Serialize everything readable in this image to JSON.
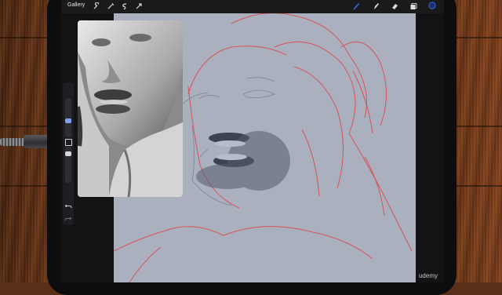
{
  "app": {
    "gallery_label": "Gallery"
  },
  "left_tools": [
    {
      "icon": "wrench-icon"
    },
    {
      "icon": "magic-wand-icon"
    },
    {
      "icon": "selection-icon"
    },
    {
      "icon": "transform-arrow-icon"
    }
  ],
  "right_tools": [
    {
      "icon": "brush-icon",
      "active": true,
      "color": "#3b6ff0"
    },
    {
      "icon": "smudge-icon"
    },
    {
      "icon": "eraser-icon"
    },
    {
      "icon": "layers-icon"
    },
    {
      "icon": "color-swatch-icon",
      "color": "#1f2e6a"
    }
  ],
  "reference": {
    "icon": "reference-photo"
  },
  "colors": {
    "canvas": "#aab0be",
    "sketch_line": "#d8525a",
    "accent": "#3b6ff0"
  },
  "watermark": "udemy"
}
